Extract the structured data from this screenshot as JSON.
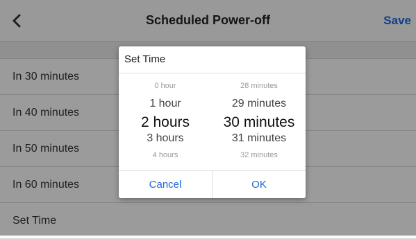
{
  "header": {
    "title": "Scheduled Power-off",
    "save_label": "Save",
    "back_icon": "chevron-left-icon"
  },
  "list": {
    "rows": [
      {
        "label": "In 30 minutes"
      },
      {
        "label": "In 40 minutes"
      },
      {
        "label": "In 50 minutes"
      },
      {
        "label": "In 60 minutes"
      },
      {
        "label": "Set Time"
      }
    ]
  },
  "dialog": {
    "title": "Set Time",
    "hours": [
      "0 hour",
      "1 hour",
      "2 hours",
      "3 hours",
      "4 hours"
    ],
    "minutes": [
      "28 minutes",
      "29 minutes",
      "30 minutes",
      "31 minutes",
      "32 minutes"
    ],
    "selected_hours": "2 hours",
    "selected_minutes": "30 minutes",
    "cancel_label": "Cancel",
    "ok_label": "OK"
  },
  "colors": {
    "accent": "#1e66d8",
    "background": "#f0f0f0"
  }
}
